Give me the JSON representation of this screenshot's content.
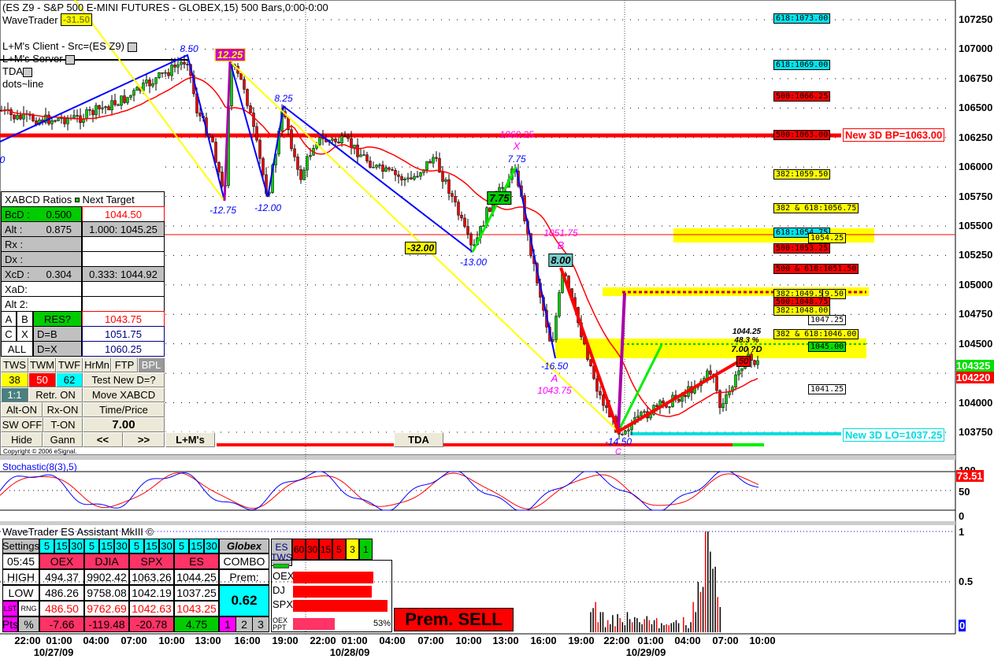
{
  "header": {
    "title": "(ES Z9 - S&P 500 E-MINI FUTURES - GLOBEX,15) 500 Bars,0:00-0:00",
    "wavetrader": "WaveTrader",
    "wavetrader_box": "-31.50",
    "client": "L+M's Client - Src=(ES Z9)",
    "server": "L+M's Server",
    "tda": "TDA",
    "dots": "dots~line"
  },
  "price_axis": [
    "107250",
    "107000",
    "106750",
    "106500",
    "106250",
    "106000",
    "105750",
    "105500",
    "105250",
    "105000",
    "104750",
    "104500",
    "104000",
    "103750"
  ],
  "price_badges": {
    "last": "104325",
    "ma": "104220",
    "last_color": "#00e000",
    "ma_color": "#ff0000"
  },
  "levels": [
    {
      "text": "618:1073.00",
      "bg": "#00e5ee"
    },
    {
      "text": "618:1069.00",
      "bg": "#00e5ee"
    },
    {
      "text": "500:1066.25",
      "bg": "#ff0000"
    },
    {
      "text": "500:1063.00",
      "bg": "#ff0000"
    },
    {
      "text": "382:1059.50",
      "bg": "#ffff00"
    },
    {
      "text": "382 & 618:1056.75",
      "bg": "#ffff00"
    },
    {
      "text": "618:1054.75",
      "bg": "#00e5ee"
    },
    {
      "text": "1054.25",
      "bg": "#ffff00"
    },
    {
      "text": "500:1053.25",
      "bg": "#ff0000"
    },
    {
      "text": "500 & 618:1051.50",
      "bg": "#ff0000"
    },
    {
      "text": "382:1049.50",
      "bg": "#ffff00"
    },
    {
      "text": "9.50",
      "bg": "#ffff00"
    },
    {
      "text": "500:1048.75",
      "bg": "#ff0000"
    },
    {
      "text": "382:1048.00",
      "bg": "#ffff00"
    },
    {
      "text": "1047.25",
      "bg": "#ffffff"
    },
    {
      "text": "382 & 618:1046.00",
      "bg": "#ffff00"
    },
    {
      "text": "1045.00",
      "bg": "#00e000"
    },
    {
      "text": "1041.25",
      "bg": "#ffffff"
    }
  ],
  "new_bp": "New 3D BP=1063.00",
  "new_lo": "New 3D LO=1037.25",
  "annotations": {
    "a850": "8.50",
    "a1225": "12.25",
    "a1275": "-12.75",
    "a1200": "-12.00",
    "a825": "8.25",
    "a3200": "-32.00",
    "a1300": "-13.00",
    "a775box": "7.75",
    "x_price": "1060.25",
    "x": "X",
    "x775": "7.75",
    "b_price": "1051.75",
    "b": "B",
    "b800": "8.00",
    "a1650": "-16.50",
    "a": "A",
    "a_price": "1043.75",
    "c1450": "-14.50",
    "c": "C",
    "d_price": "1044.25",
    "d_pct": "48.3 %",
    "d_lbl": "7.00 ?D",
    "d_box": "50",
    "left0": "0"
  },
  "xabcd": {
    "header": "XABCD Ratios",
    "next": "Next Target",
    "rows": [
      {
        "l": "BcD :",
        "v": "0.500",
        "t": "1044.50"
      },
      {
        "l": "Alt  :",
        "v": "0.875",
        "t": "1.000: 1045.25"
      },
      {
        "l": "Rx  :",
        "v": "",
        "t": ""
      },
      {
        "l": "Dx  :",
        "v": "",
        "t": ""
      },
      {
        "l": "XcD :",
        "v": "0.304",
        "t": "0.333: 1044.92"
      },
      {
        "l": "XaD:",
        "v": "",
        "t": ""
      },
      {
        "l": "Alt 2:",
        "v": "",
        "t": ""
      }
    ],
    "a": "A",
    "b": "B",
    "res": "RES?",
    "res_val": "1043.75",
    "c": "C",
    "x": "X",
    "db": "D=B",
    "db_val": "1051.75",
    "all": "ALL",
    "dx": "D=X",
    "dx_val": "1060.25"
  },
  "buttons": {
    "tws": "TWS",
    "twm": "TWM",
    "twf": "TWF",
    "hrmn": "HrMn",
    "ftp": "FTP",
    "bpl": "BPL",
    "n38": "38",
    "n50": "50",
    "n62": "62",
    "test": "Test New D=?",
    "r11": "1:1",
    "retr": "Retr. ON",
    "move": "Move XABCD",
    "alt": "Alt-ON",
    "rx": "Rx-ON",
    "tp": "Time/Price",
    "sw": "SW OFF",
    "ton": "T-ON",
    "val": "7.00",
    "hide": "Hide",
    "gann": "Gann",
    "prev": "<<",
    "next": ">>",
    "lm": "L+M's",
    "tda": "TDA"
  },
  "copyright": "Copyright © 2006 eSignal.",
  "stochastic": {
    "title": "Stochastic(8(3),5)",
    "ticks": [
      "100",
      "50",
      "0"
    ],
    "value": "73.51"
  },
  "assistant": {
    "title": "WaveTrader ES Assistant MkIII ©",
    "settings": "Settings",
    "tf": [
      "5",
      "15",
      "30"
    ],
    "globex": "Globex",
    "time": "05:45",
    "cols": [
      "OEX",
      "DJIA",
      "SPX",
      "ES"
    ],
    "combo": "COMBO",
    "high": "HIGH",
    "low": "LOW",
    "lst": "LST",
    "rng": "RNG",
    "pts": "Pts",
    "pct": "%",
    "high_vals": [
      "494.37",
      "9902.42",
      "1063.26",
      "1044.25"
    ],
    "low_vals": [
      "486.26",
      "9758.08",
      "1042.19",
      "1037.25"
    ],
    "lst_vals": [
      "486.50",
      "9762.69",
      "1042.63",
      "1043.25"
    ],
    "pts_vals": [
      "-7.66",
      "-119.48",
      "-20.78",
      "4.75"
    ],
    "prem": "Prem:",
    "prem_val": "0.62",
    "pages": [
      "1",
      "2",
      "3"
    ],
    "es_tws": "ES TWS",
    "tws": [
      "60",
      "30",
      "15",
      "5",
      "3",
      "1"
    ],
    "bars": [
      {
        "l": "OEX",
        "v": 0.82
      },
      {
        "l": "DJ",
        "v": 0.81
      },
      {
        "l": "SPX",
        "v": 0.97
      }
    ],
    "ppt": "OEX PPT",
    "ppt_pct": "53%",
    "ppt_val": 0.53,
    "signal": "Prem. SELL"
  },
  "volume_axis": [
    "1",
    "0.5",
    "0"
  ],
  "time_axis": [
    "22:00",
    "01:00",
    "04:00",
    "07:00",
    "10:00",
    "13:00",
    "16:00",
    "19:00",
    "22:00",
    "01:00",
    "04:00",
    "07:00",
    "10:00",
    "13:00",
    "16:00",
    "19:00",
    "22:00",
    "01:00",
    "04:00",
    "07:00",
    "10:00"
  ],
  "dates": [
    "10/27/09",
    "10/28/09",
    "10/29/09"
  ]
}
